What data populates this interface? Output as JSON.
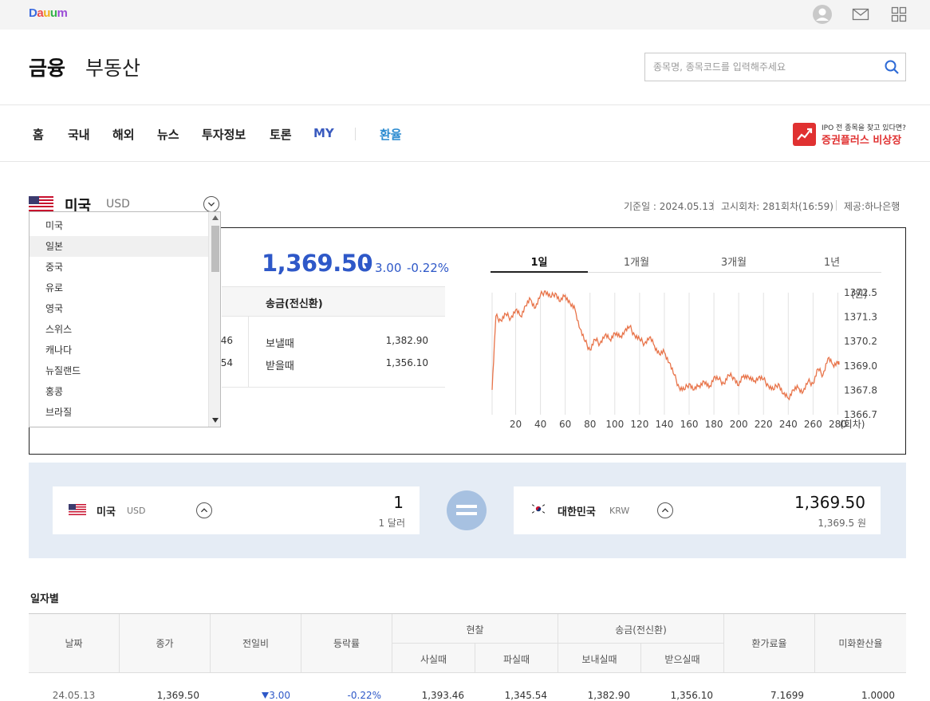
{
  "topbar": {
    "logo_letters": [
      "D",
      "a",
      "u",
      "u",
      "m"
    ],
    "icons": [
      "user-icon",
      "mail-icon",
      "apps-grid-icon"
    ]
  },
  "header": {
    "brand_main": "금융",
    "brand_sub": "부동산",
    "search_placeholder": "종목명, 종목코드를 입력해주세요"
  },
  "nav": {
    "items": [
      "홈",
      "국내",
      "해외",
      "뉴스",
      "투자정보",
      "토론",
      "MY",
      "환율"
    ],
    "ad_line1": "IPO 전 종목을 찾고 있다면?",
    "ad_line2": "증권플러스 비상장"
  },
  "currency": {
    "name": "미국",
    "code": "USD",
    "base_date": "기준일 : 2024.05.13",
    "notice": "고시회차: 281회차(16:59)",
    "provider": "제공:하나은행"
  },
  "rate": {
    "price": "1,369.50",
    "change": "3.00",
    "change_pct": "-0.22%",
    "remit_header": "송금(전신환)",
    "cash_buy_partial": "46",
    "cash_sell_partial": "54",
    "send_label": "보낼때",
    "send_value": "1,382.90",
    "receive_label": "받을때",
    "receive_value": "1,356.10"
  },
  "dropdown": {
    "options": [
      "미국",
      "일본",
      "중국",
      "유로",
      "영국",
      "스위스",
      "캐나다",
      "뉴질랜드",
      "홍콩",
      "브라질"
    ],
    "hovered": "일본"
  },
  "chart_tabs": [
    "1일",
    "1개월",
    "3개월",
    "1년"
  ],
  "chart_data": {
    "type": "line",
    "ylabel": "(원)",
    "xlabel": "(회차)",
    "y_ticks": [
      "1372.52",
      "1371.36",
      "1370.20",
      "1369.04",
      "1367.88",
      "1366.72"
    ],
    "x_ticks": [
      "20",
      "40",
      "60",
      "80",
      "100",
      "120",
      "140",
      "160",
      "180",
      "200",
      "220",
      "240",
      "260",
      "280"
    ],
    "ylim": [
      1366.72,
      1372.52
    ],
    "xlim": [
      5,
      281
    ],
    "color": "#e8744a",
    "x": [
      1,
      4,
      8,
      12,
      16,
      20,
      24,
      28,
      32,
      36,
      40,
      44,
      48,
      52,
      56,
      60,
      64,
      68,
      72,
      76,
      80,
      84,
      88,
      92,
      96,
      100,
      104,
      108,
      112,
      116,
      120,
      124,
      128,
      132,
      136,
      140,
      144,
      148,
      152,
      156,
      160,
      164,
      168,
      172,
      176,
      180,
      184,
      188,
      192,
      196,
      200,
      204,
      208,
      212,
      216,
      220,
      224,
      228,
      232,
      236,
      240,
      244,
      248,
      252,
      256,
      260,
      264,
      268,
      272,
      276,
      280,
      281
    ],
    "y": [
      1367.9,
      1371.4,
      1371.2,
      1371.5,
      1371.3,
      1371.7,
      1371.4,
      1371.9,
      1372.2,
      1371.8,
      1372.4,
      1372.6,
      1372.3,
      1372.5,
      1372.1,
      1372.4,
      1372.0,
      1371.7,
      1370.8,
      1370.2,
      1369.8,
      1370.3,
      1370.1,
      1370.5,
      1370.3,
      1370.6,
      1370.4,
      1370.7,
      1370.9,
      1370.5,
      1370.3,
      1370.1,
      1370.4,
      1370.0,
      1369.6,
      1369.7,
      1369.2,
      1368.6,
      1368.0,
      1367.9,
      1368.2,
      1367.9,
      1368.1,
      1368.3,
      1368.0,
      1368.5,
      1368.4,
      1368.2,
      1368.6,
      1368.5,
      1368.1,
      1368.6,
      1368.5,
      1368.3,
      1368.5,
      1368.4,
      1368.1,
      1367.9,
      1368.2,
      1367.7,
      1367.5,
      1367.9,
      1368.0,
      1367.8,
      1368.3,
      1368.2,
      1368.9,
      1368.6,
      1369.4,
      1369.1,
      1369.2,
      1369.1
    ]
  },
  "converter": {
    "from_name": "미국",
    "from_code": "USD",
    "from_amount": "1",
    "from_unit": "1 달러",
    "to_name": "대한민국",
    "to_code": "KRW",
    "to_amount": "1,369.50",
    "to_unit": "1,369.5 원"
  },
  "daily": {
    "title": "일자별",
    "headers": {
      "date": "날짜",
      "close": "종가",
      "prev": "전일비",
      "pct": "등락률",
      "cash": "현찰",
      "cash_buy": "사실때",
      "cash_sell": "파실때",
      "remit": "송금(전신환)",
      "send": "보내실때",
      "receive": "받으실때",
      "fx_rate": "환가료율",
      "usd_rate": "미화환산율"
    },
    "rows": [
      {
        "date": "24.05.13",
        "close": "1,369.50",
        "prev": "3.00",
        "pct": "-0.22%",
        "cash_buy": "1,393.46",
        "cash_sell": "1,345.54",
        "send": "1,382.90",
        "receive": "1,356.10",
        "fx_rate": "7.1699",
        "usd_rate": "1.0000"
      }
    ]
  }
}
